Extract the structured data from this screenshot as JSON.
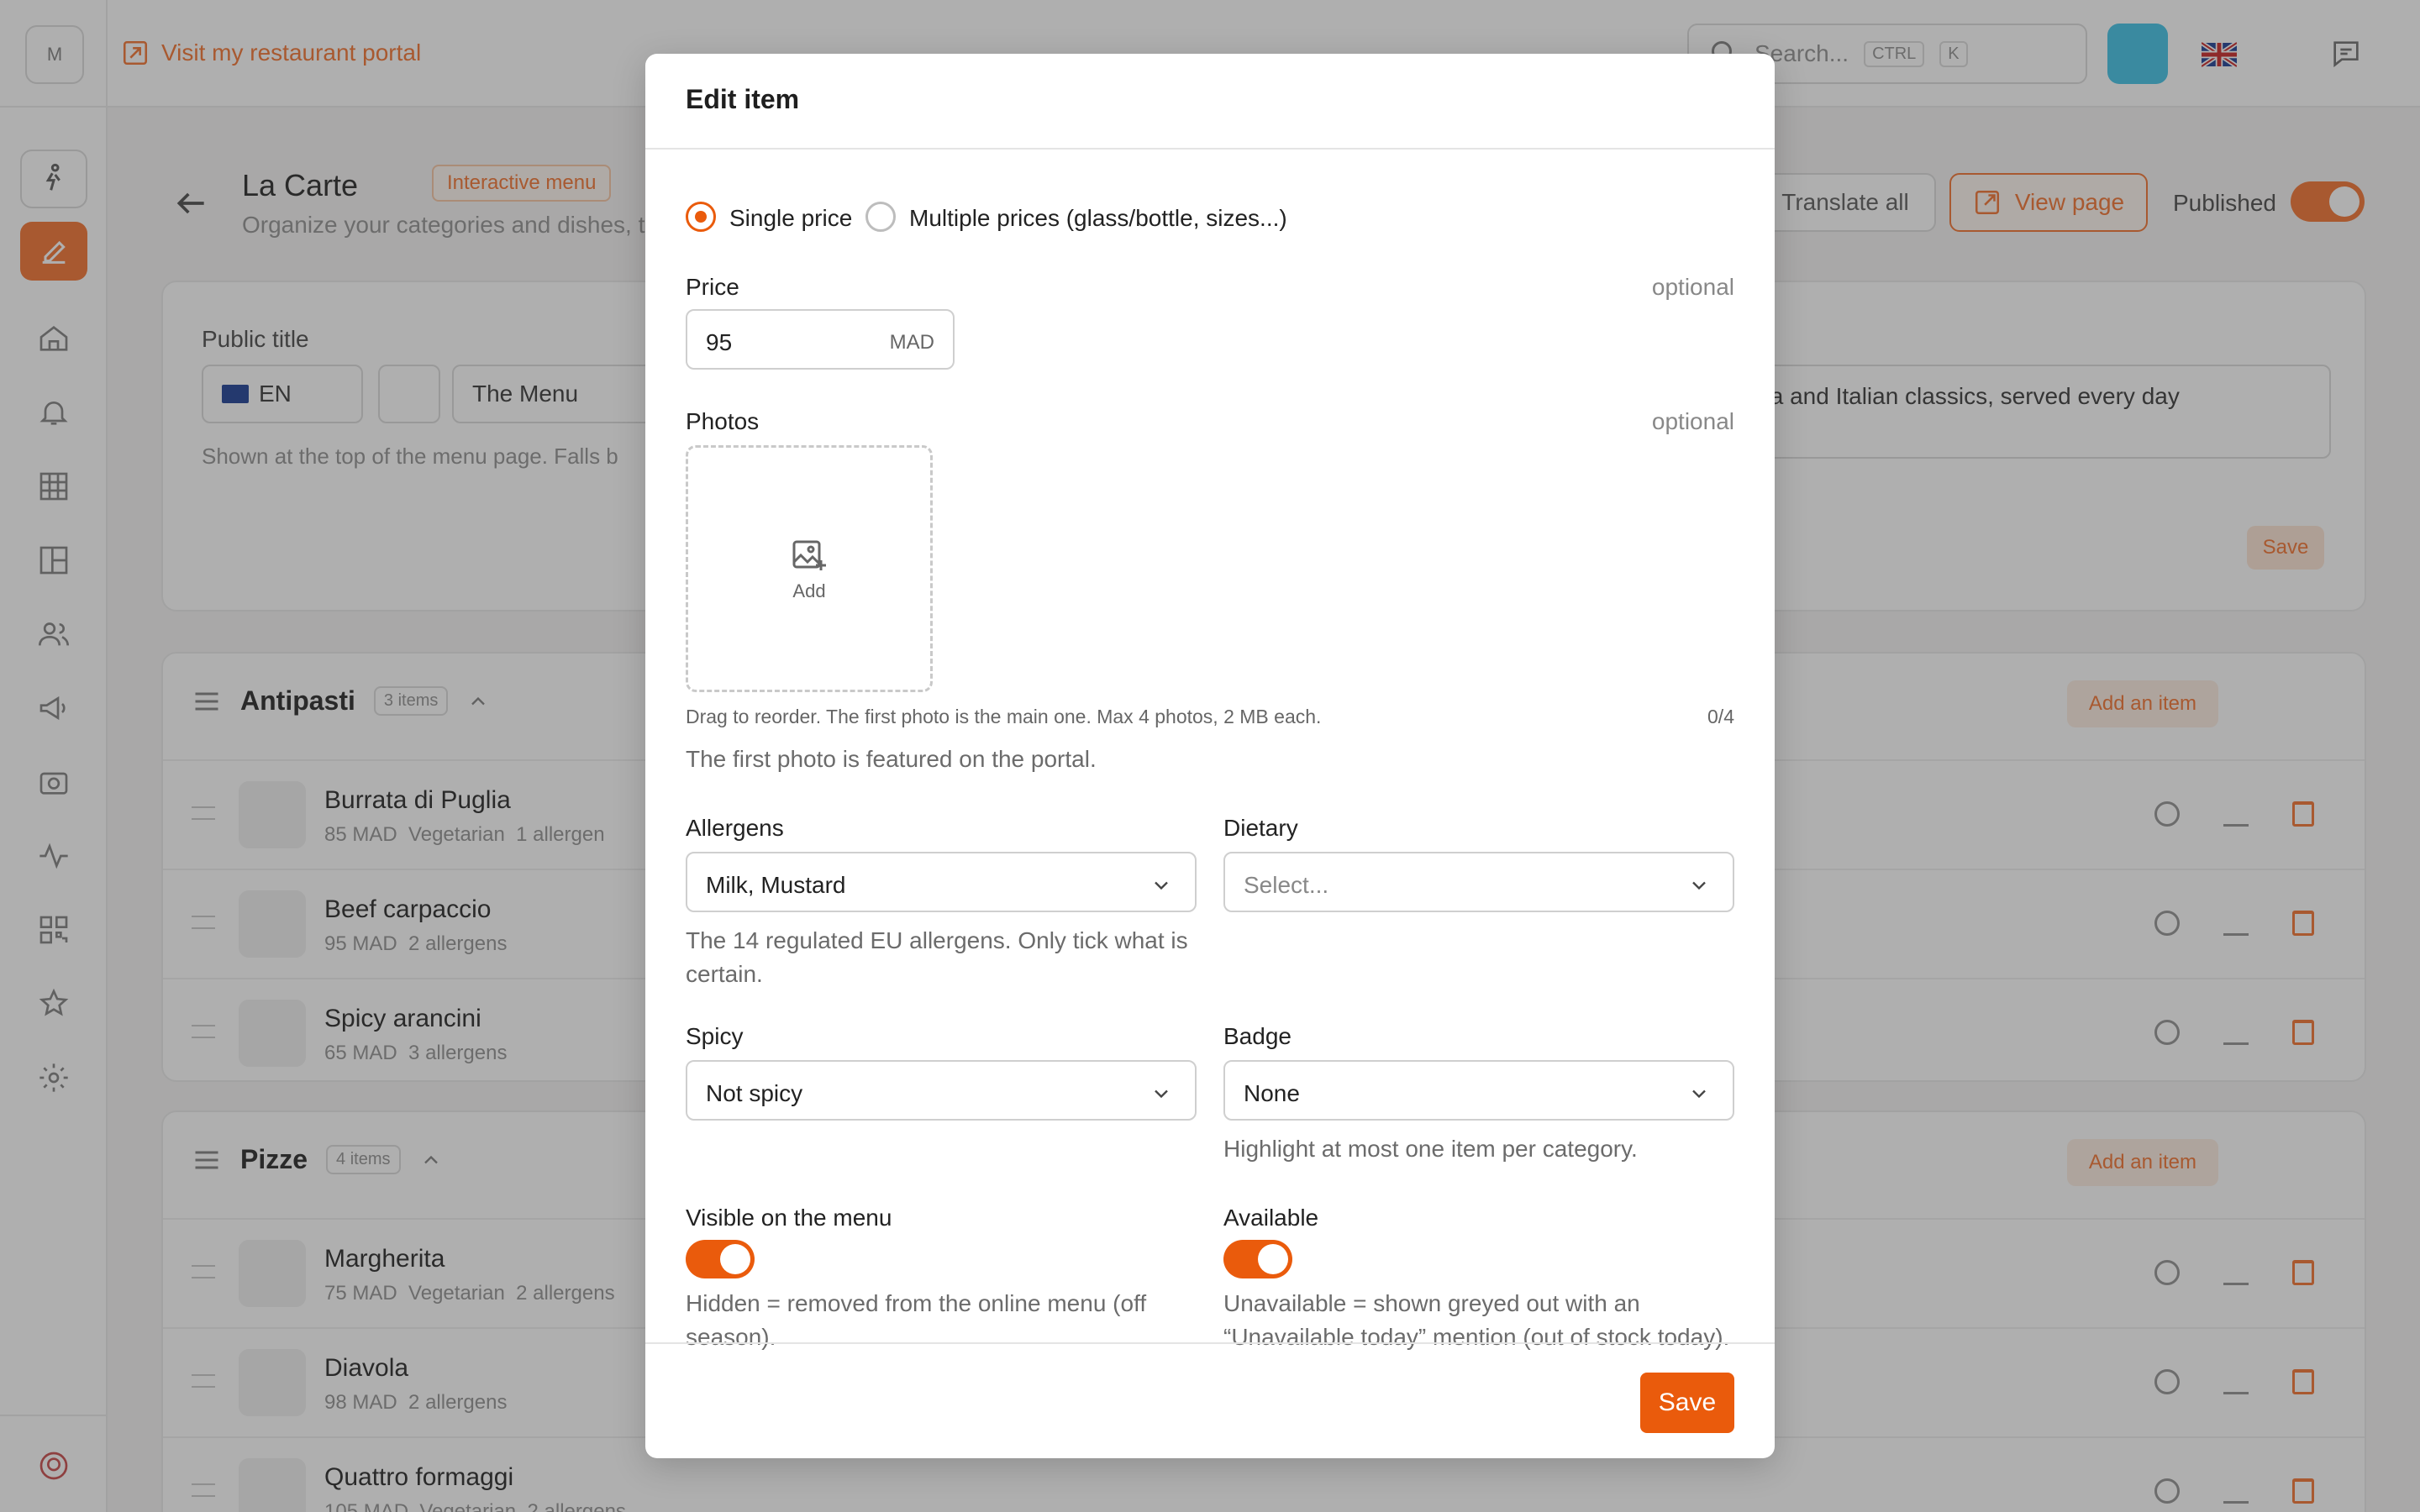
{
  "sidebar": {
    "avatar_letter": "M"
  },
  "topbar": {
    "portal_link": "Visit my restaurant portal",
    "search_placeholder": "Search...",
    "kbd_ctrl": "CTRL",
    "kbd_k": "K",
    "language_flag": "uk-flag"
  },
  "page": {
    "title": "La Carte",
    "badge": "Interactive menu",
    "subtitle": "Organize your categories and dishes, t",
    "translate_all": "Translate all",
    "view_page": "View page",
    "published_label": "Published",
    "published": true
  },
  "settings_card": {
    "public_title_label": "Public title",
    "lang": "EN",
    "title_value": "The Menu",
    "hint": "Shown at the top of the menu page. Falls b",
    "description_value": "an pizza and Italian classics, served every day",
    "save": "Save"
  },
  "categories": [
    {
      "name": "Antipasti",
      "count": "3 items",
      "add_label": "Add an item",
      "items": [
        {
          "name": "Burrata di Puglia",
          "price": "85 MAD",
          "tag": "Vegetarian",
          "allergens": "1 allergen"
        },
        {
          "name": "Beef carpaccio",
          "price": "95 MAD",
          "tag": "",
          "allergens": "2 allergens"
        },
        {
          "name": "Spicy arancini",
          "price": "65 MAD",
          "tag": "",
          "allergens": "3 allergens"
        }
      ]
    },
    {
      "name": "Pizze",
      "count": "4 items",
      "add_label": "Add an item",
      "items": [
        {
          "name": "Margherita",
          "price": "75 MAD",
          "tag": "Vegetarian",
          "allergens": "2 allergens"
        },
        {
          "name": "Diavola",
          "price": "98 MAD",
          "tag": "",
          "allergens": "2 allergens"
        },
        {
          "name": "Quattro formaggi",
          "price": "105 MAD",
          "tag": "Vegetarian",
          "allergens": "2 allergens"
        }
      ]
    }
  ],
  "modal": {
    "title": "Edit item",
    "pricing": {
      "single_label": "Single price",
      "multiple_label": "Multiple prices (glass/bottle, sizes...)",
      "selected": "single"
    },
    "price": {
      "label": "Price",
      "optional": "optional",
      "value": "95",
      "unit": "MAD"
    },
    "photos": {
      "label": "Photos",
      "optional": "optional",
      "add_label": "Add",
      "drag_hint": "Drag to reorder. The first photo is the main one. Max 4 photos, 2 MB each.",
      "counter": "0/4",
      "featured_note": "The first photo is featured on the portal."
    },
    "allergens": {
      "label": "Allergens",
      "value": "Milk, Mustard",
      "help": "The 14 regulated EU allergens. Only tick what is certain."
    },
    "dietary": {
      "label": "Dietary",
      "placeholder": "Select..."
    },
    "spicy": {
      "label": "Spicy",
      "value": "Not spicy"
    },
    "badge": {
      "label": "Badge",
      "value": "None",
      "help": "Highlight at most one item per category."
    },
    "visible": {
      "label": "Visible on the menu",
      "on": true,
      "help": "Hidden = removed from the online menu (off season)."
    },
    "available": {
      "label": "Available",
      "on": true,
      "help": "Unavailable = shown greyed out with an “Unavailable today” mention (out of stock today)."
    },
    "save_label": "Save"
  },
  "colors": {
    "accent": "#ea5b0c",
    "accent_light": "#f47c3c",
    "overlay": "rgba(25,25,25,0.35)"
  }
}
